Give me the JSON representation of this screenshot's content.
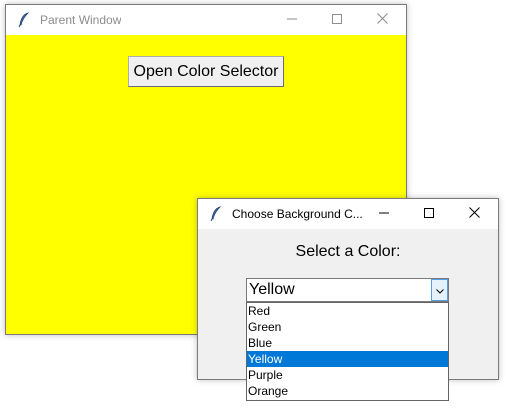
{
  "parent_window": {
    "title": "Parent Window",
    "background_color": "#ffff00",
    "open_button_label": "Open Color Selector"
  },
  "child_window": {
    "title": "Choose Background C...",
    "prompt": "Select a Color:",
    "combobox": {
      "value": "Yellow",
      "options": [
        "Red",
        "Green",
        "Blue",
        "Yellow",
        "Purple",
        "Orange"
      ],
      "selected_index": 3
    }
  },
  "colors": {
    "selection_highlight": "#0078d7",
    "titlebar_inactive_text": "#8c8c8c"
  },
  "icons": {
    "app": "feather-icon",
    "minimize": "minimize-icon",
    "maximize": "maximize-icon",
    "close": "close-icon",
    "dropdown": "chevron-down-icon"
  }
}
